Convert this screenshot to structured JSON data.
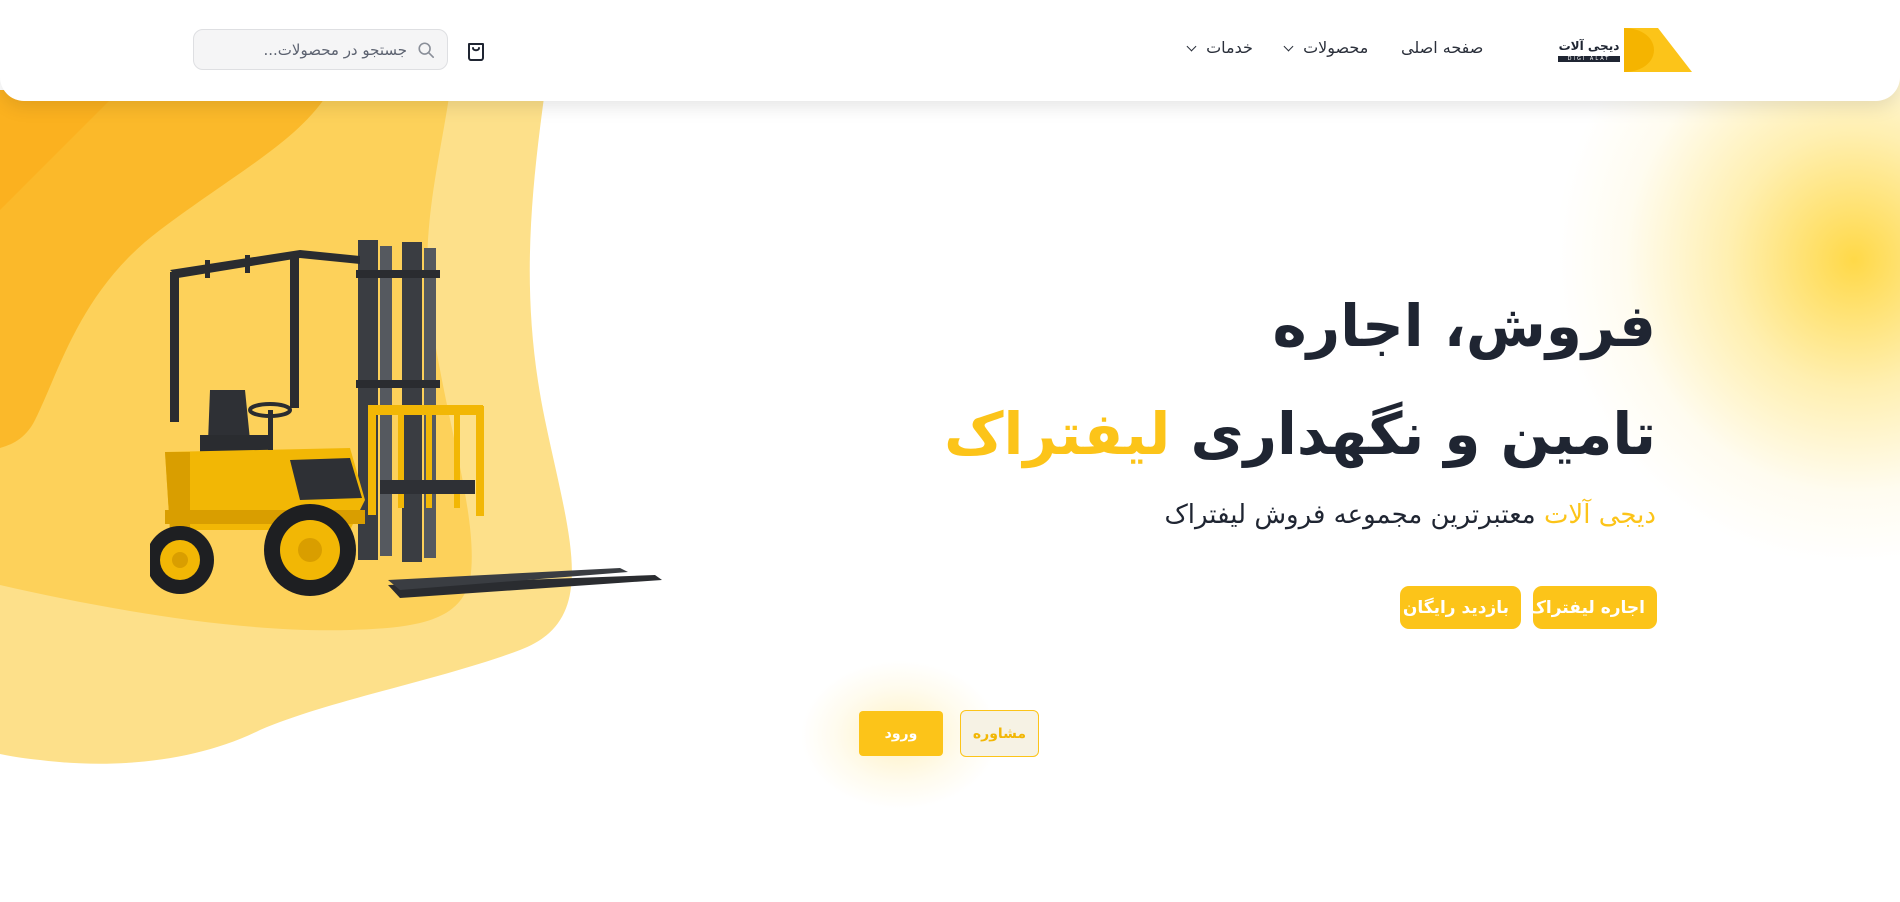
{
  "brand": {
    "name": "دیجی آلات",
    "subtitle": "DIGI ALAT",
    "accent_color": "#fcc419",
    "dark_color": "#1f2532"
  },
  "nav": {
    "home": "صفحه اصلی",
    "products": "محصولات",
    "services": "خدمات"
  },
  "header": {
    "cart_icon": "shopping-bag-icon",
    "search_placeholder": "جستجو در محصولات...",
    "search_icon": "search-icon"
  },
  "hero": {
    "line1": "فروش، اجاره",
    "line2_main": "تامین و نگهداری ",
    "line2_accent": "لیفتراک",
    "subtitle_accent": "دیجی آلات",
    "subtitle_rest": " معتبرترین مجموعه فروش لیفتراک",
    "btn_rent": "اجاره لیفتراک",
    "btn_visit": "بازدید رایگان"
  },
  "actions": {
    "login": "ورود",
    "consult": "مشاوره"
  }
}
